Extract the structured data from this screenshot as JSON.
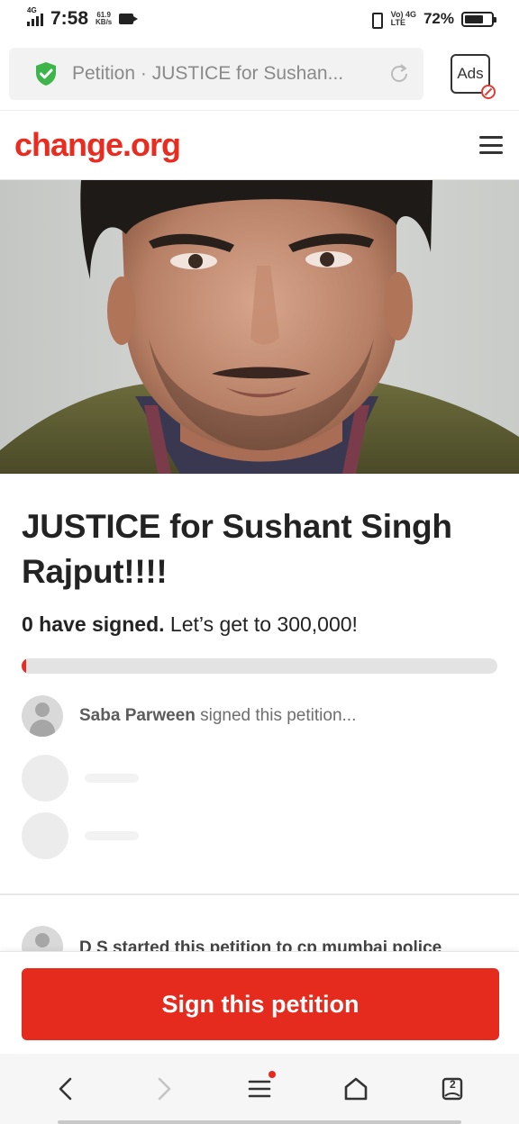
{
  "status_bar": {
    "network_left": "4G",
    "time": "7:58",
    "speed_value": "61.9",
    "speed_unit": "KB/s",
    "network_right_top": "Vo) 4G",
    "network_right_bottom": "LTE",
    "battery_percent": "72%",
    "battery_level": 0.72
  },
  "browser": {
    "url_text": "Petition · JUSTICE for Sushan...",
    "ads_label": "Ads",
    "tab_count": "2"
  },
  "site": {
    "logo": "change.org"
  },
  "petition": {
    "title": "JUSTICE for Sushant Singh Rajput!!!!",
    "signed_bold": "0 have signed.",
    "signed_rest": "Let’s get to 300,000!",
    "progress_fraction": 0.01,
    "recent_signer_name": "Saba Parween",
    "recent_signer_action": "signed this petition...",
    "starter_text": "D S started this petition to cp mumbai police"
  },
  "actions": {
    "sign_label": "Sign this petition"
  },
  "colors": {
    "brand_red": "#ea2b1f",
    "shield_green": "#3db54a"
  },
  "icons": {
    "back": "chevron-left-icon",
    "forward": "chevron-right-icon",
    "menu": "hamburger-icon",
    "home": "home-icon",
    "tabs": "tabs-icon",
    "secure": "shield-check-icon",
    "reload": "reload-icon"
  }
}
